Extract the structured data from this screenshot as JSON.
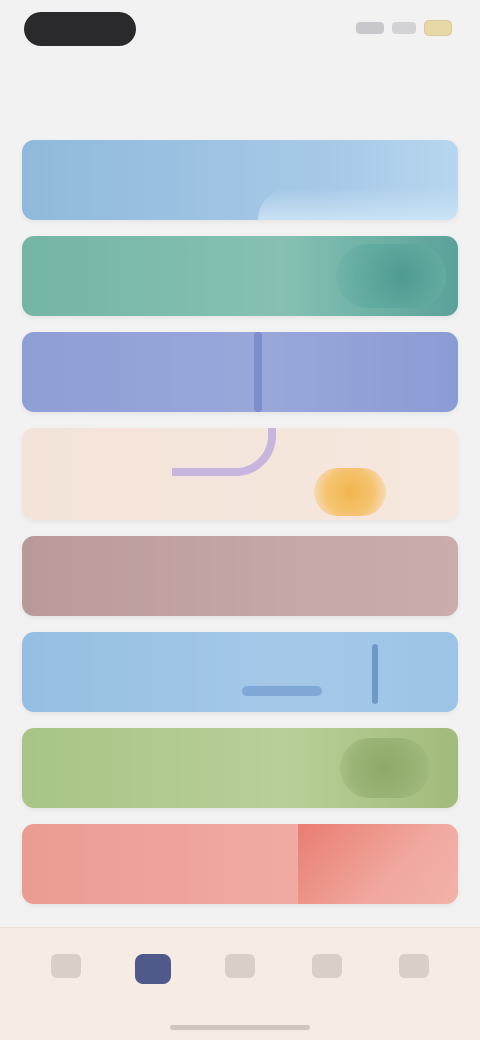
{
  "status_bar": {
    "icons": [
      "signal-icon",
      "wifi-icon",
      "battery-icon"
    ]
  },
  "header": {
    "title": ""
  },
  "categories": [
    {
      "label": "",
      "color": "#9fc3e3"
    },
    {
      "label": "",
      "color": "#7fb9ac"
    },
    {
      "label": "",
      "color": "#93a4d8"
    },
    {
      "label": "",
      "color": "#f4e4da"
    },
    {
      "label": "",
      "color": "#c4a6a5"
    },
    {
      "label": "",
      "color": "#a0c6e7"
    },
    {
      "label": "",
      "color": "#b3cc92"
    },
    {
      "label": "",
      "color": "#efa69d"
    }
  ],
  "tab_bar": {
    "tabs": [
      {
        "label": "",
        "icon": "home-icon",
        "active": false
      },
      {
        "label": "",
        "icon": "calendar-icon",
        "active": true
      },
      {
        "label": "",
        "icon": "search-icon",
        "active": false
      },
      {
        "label": "",
        "icon": "heart-icon",
        "active": false
      },
      {
        "label": "",
        "icon": "profile-icon",
        "active": false
      }
    ]
  }
}
